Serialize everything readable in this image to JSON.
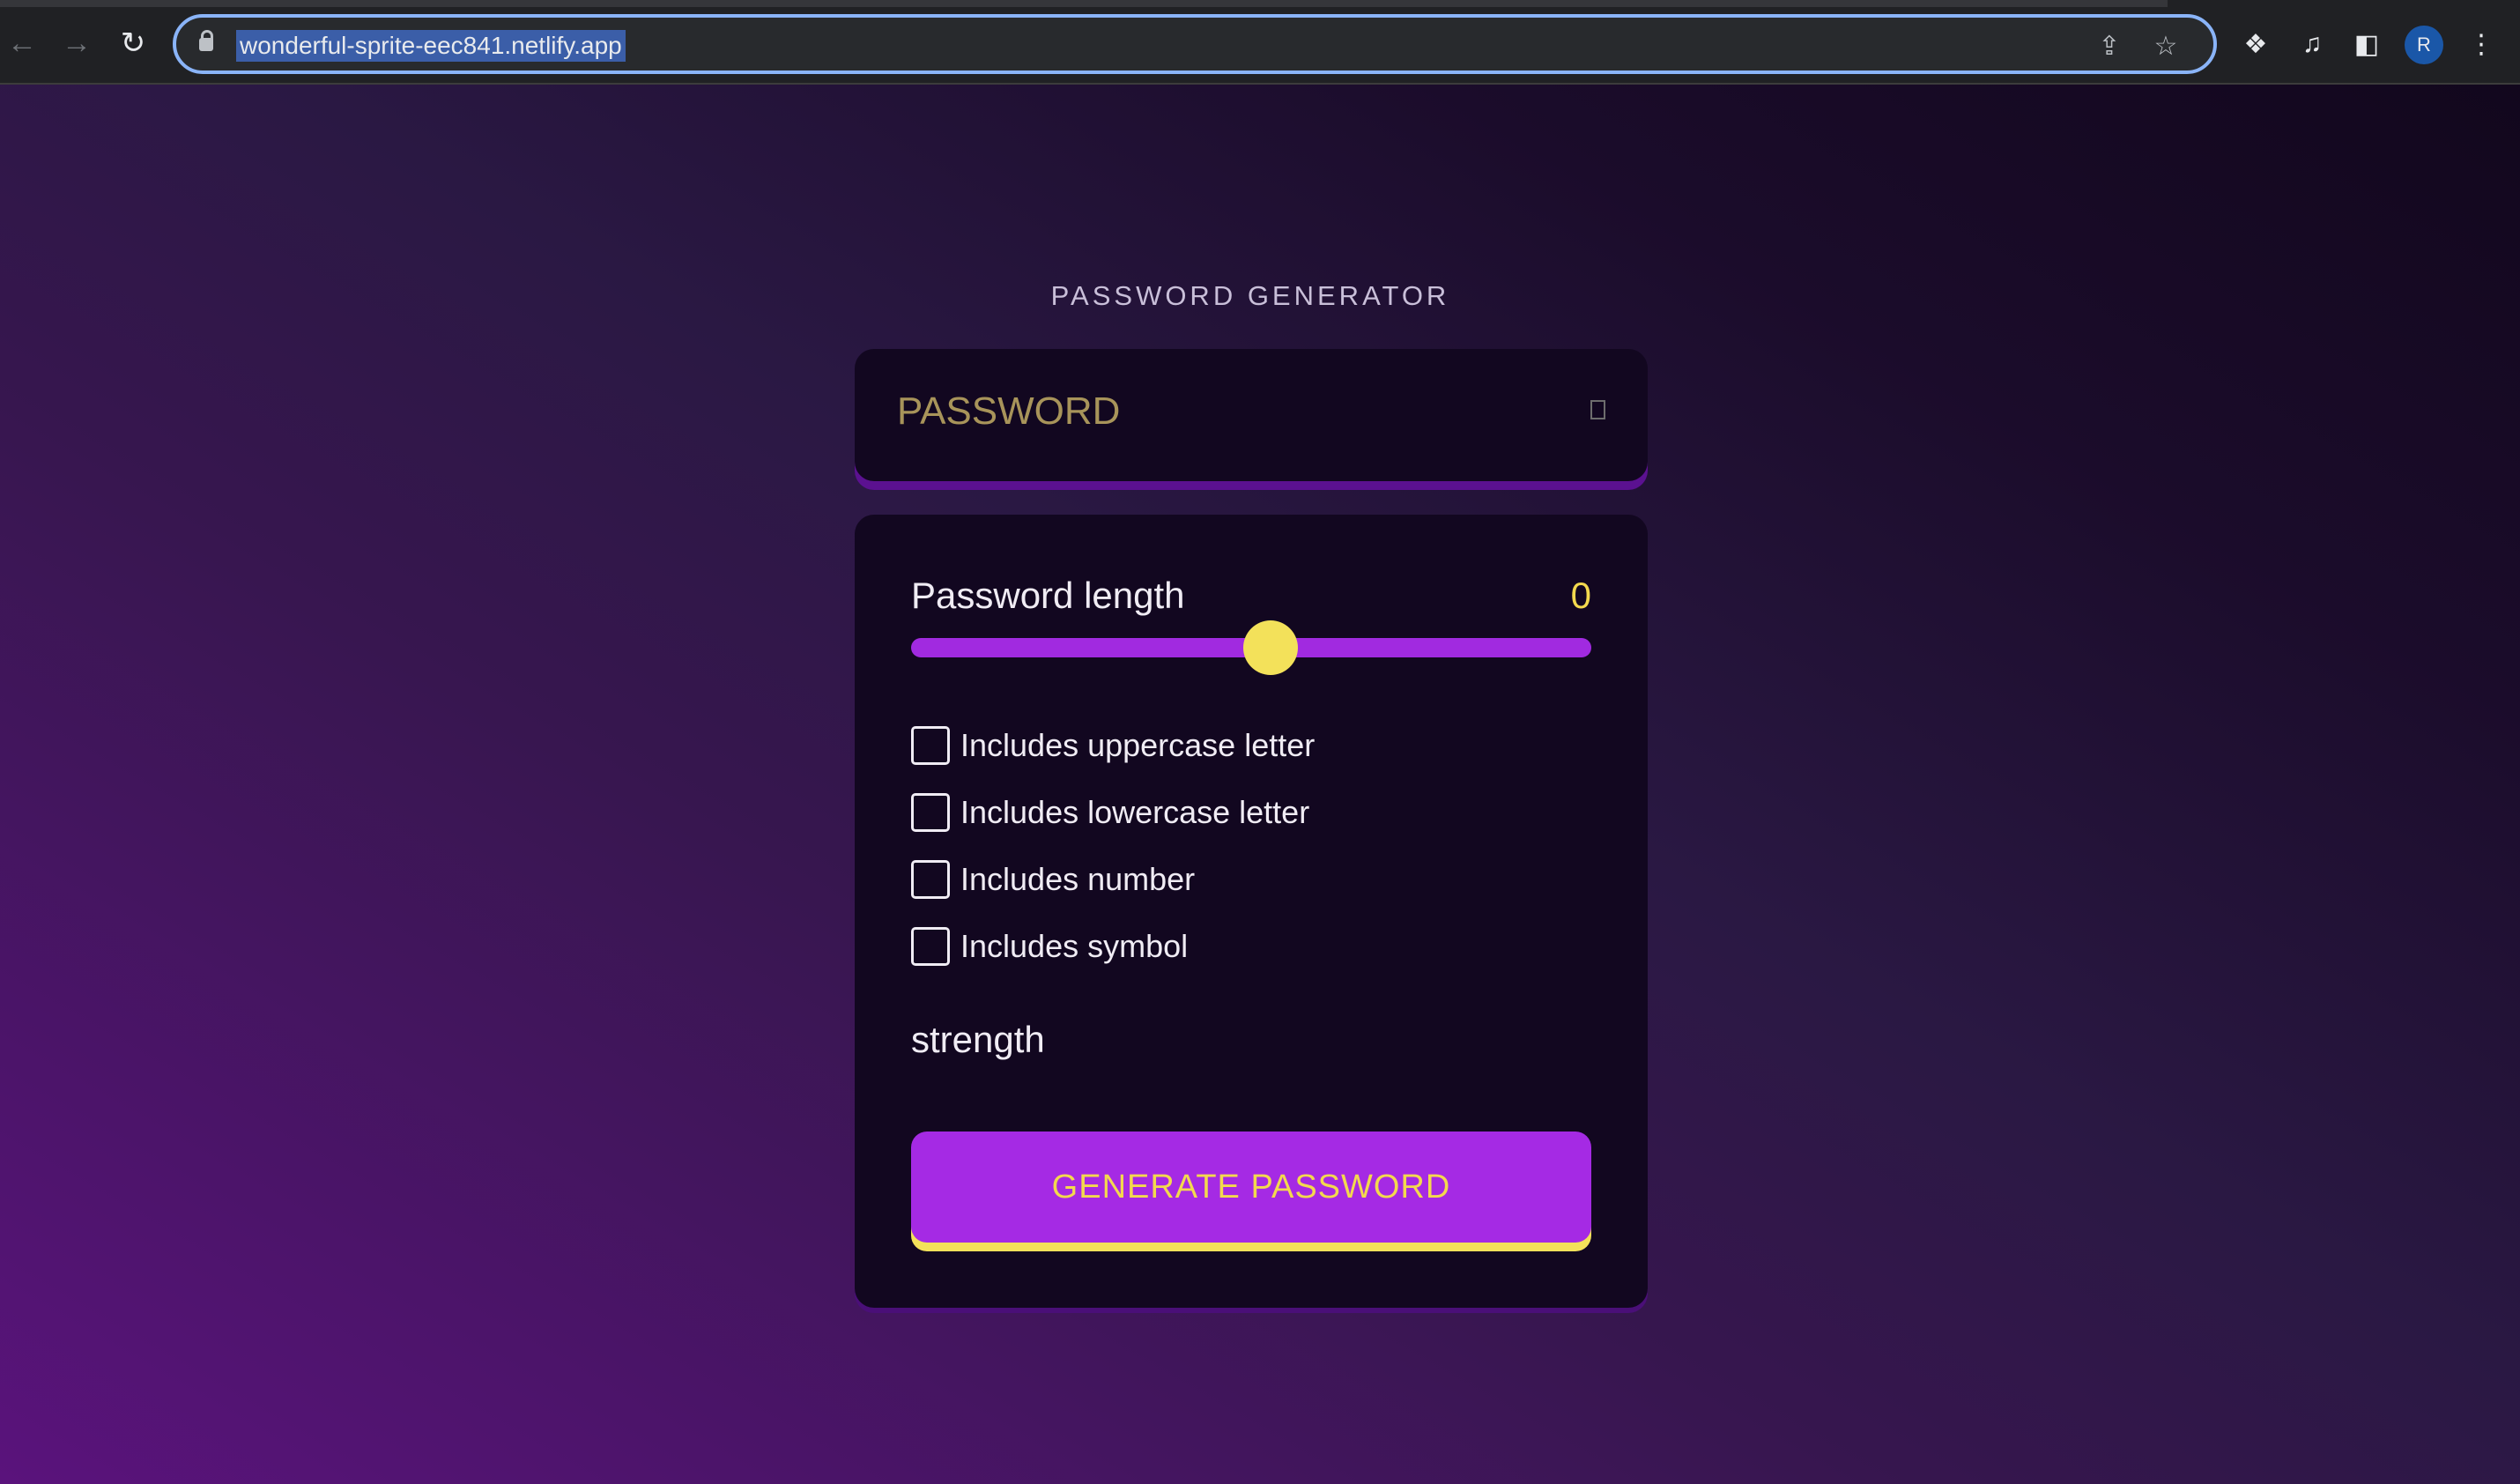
{
  "browser": {
    "url": "wonderful-sprite-eec841.netlify.app",
    "profile_initial": "R",
    "icons": {
      "back": "arrow-left-icon",
      "forward": "arrow-right-icon",
      "reload": "reload-icon",
      "lock": "lock-icon",
      "share": "share-icon",
      "bookmark": "star-icon",
      "extensions": "puzzle-icon",
      "media": "media-queue-icon",
      "side_panel": "side-panel-icon",
      "menu": "kebab-menu-icon"
    }
  },
  "app": {
    "title": "PASSWORD GENERATOR",
    "password_display": "PASSWORD",
    "length_label": "Password length",
    "length_value": "0",
    "slider_level": 0.5,
    "options": [
      {
        "label": "Includes uppercase letter",
        "checked": false
      },
      {
        "label": "Includes lowercase letter",
        "checked": false
      },
      {
        "label": "Includes number",
        "checked": false
      },
      {
        "label": "Includes symbol",
        "checked": false
      }
    ],
    "strength_label": "strength",
    "generate_label": "GENERATE PASSWORD"
  },
  "colors": {
    "accent_purple": "#a52ae4",
    "accent_yellow": "#f3e15a",
    "card_background": "#120720"
  }
}
